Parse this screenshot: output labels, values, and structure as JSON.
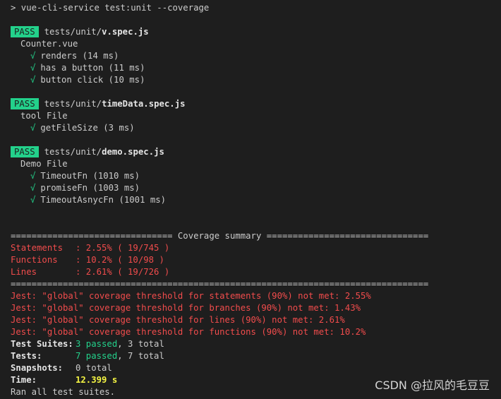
{
  "command": "> vue-cli-service test:unit --coverage",
  "suites": [
    {
      "badge": "PASS",
      "path_prefix": "tests/unit/",
      "file": "v.spec.js",
      "describe": "Counter.vue",
      "tests": [
        {
          "check": "√",
          "name": "renders (14 ms)"
        },
        {
          "check": "√",
          "name": "has a button (11 ms)"
        },
        {
          "check": "√",
          "name": "button click (10 ms)"
        }
      ]
    },
    {
      "badge": "PASS",
      "path_prefix": "tests/unit/",
      "file": "timeData.spec.js",
      "describe": "tool File",
      "tests": [
        {
          "check": "√",
          "name": "getFileSize (3 ms)"
        }
      ]
    },
    {
      "badge": "PASS",
      "path_prefix": "tests/unit/",
      "file": "demo.spec.js",
      "describe": "Demo File",
      "tests": [
        {
          "check": "√",
          "name": "TimeoutFn (1010 ms)"
        },
        {
          "check": "√",
          "name": "promiseFn (1003 ms)"
        },
        {
          "check": "√",
          "name": "TimeoutAsnycFn (1001 ms)"
        }
      ]
    }
  ],
  "coverage": {
    "header": "=============================== Coverage summary ===============================",
    "rows": [
      {
        "label": "Statements",
        "value": ": 2.55% ( 19/745 )"
      },
      {
        "label": "Functions",
        "value": ": 10.2% ( 10/98 )"
      },
      {
        "label": "Lines",
        "value": ": 2.61% ( 19/726 )"
      }
    ],
    "footer": "================================================================================"
  },
  "thresholds": [
    "Jest: \"global\" coverage threshold for statements (90%) not met: 2.55%",
    "Jest: \"global\" coverage threshold for branches (90%) not met: 1.43%",
    "Jest: \"global\" coverage threshold for lines (90%) not met: 2.61%",
    "Jest: \"global\" coverage threshold for functions (90%) not met: 10.2%"
  ],
  "summary": {
    "suites": {
      "label": "Test Suites:",
      "passed": "3 passed",
      "rest": ", 3 total"
    },
    "tests": {
      "label": "Tests:",
      "passed": "7 passed",
      "rest": ", 7 total"
    },
    "snapshots": {
      "label": "Snapshots:",
      "value": "0 total"
    },
    "time": {
      "label": "Time:",
      "value": "12.399 s"
    },
    "ran": "Ran all test suites."
  },
  "watermark": "CSDN @拉风的毛豆豆",
  "colors": {
    "background": "#1e1e1e",
    "pass_badge": "#23d18b",
    "error_red": "#f14c4c",
    "time_yellow": "#f5f543"
  }
}
